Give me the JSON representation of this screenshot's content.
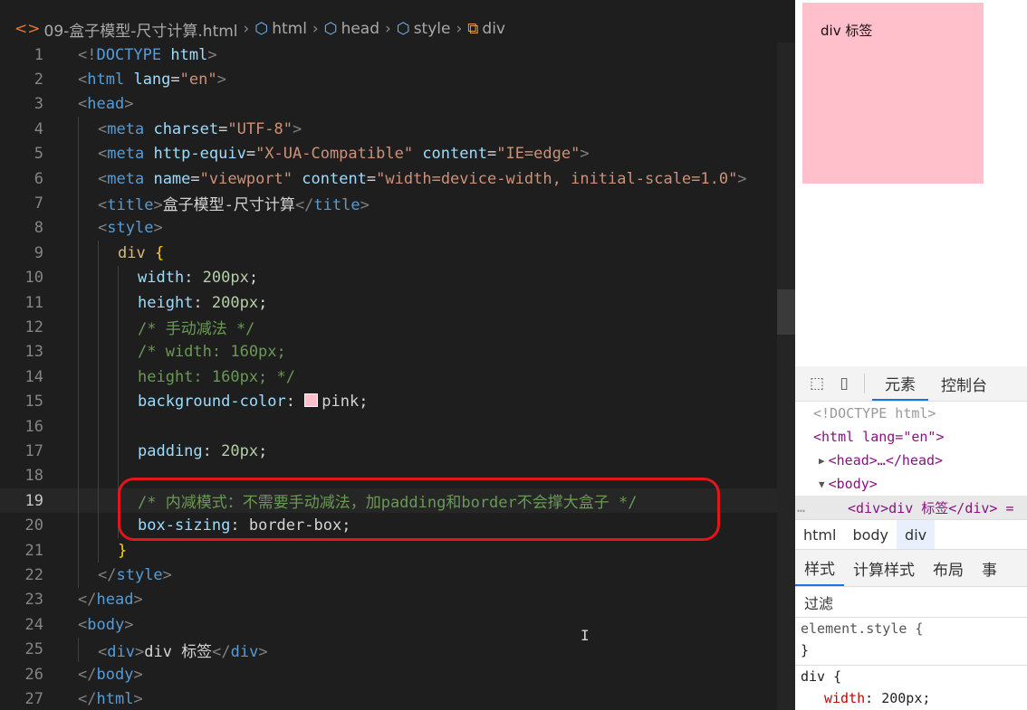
{
  "breadcrumb": {
    "file": "09-盒子模型-尺寸计算.html",
    "items": [
      "html",
      "head",
      "style",
      "div"
    ]
  },
  "editor": {
    "lines": [
      {
        "n": "1",
        "parts": [
          [
            "pn",
            "<!"
          ],
          [
            "tg",
            "DOCTYPE"
          ],
          [
            "tx",
            " "
          ],
          [
            "at",
            "html"
          ],
          [
            "pn",
            ">"
          ]
        ]
      },
      {
        "n": "2",
        "parts": [
          [
            "pn",
            "<"
          ],
          [
            "tg",
            "html"
          ],
          [
            "tx",
            " "
          ],
          [
            "at",
            "lang"
          ],
          [
            "tx",
            "="
          ],
          [
            "st",
            "\"en\""
          ],
          [
            "pn",
            ">"
          ]
        ]
      },
      {
        "n": "3",
        "parts": [
          [
            "pn",
            "<"
          ],
          [
            "tg",
            "head"
          ],
          [
            "pn",
            ">"
          ]
        ]
      },
      {
        "n": "4",
        "parts": [
          [
            "pn",
            "<"
          ],
          [
            "tg",
            "meta"
          ],
          [
            "tx",
            " "
          ],
          [
            "at",
            "charset"
          ],
          [
            "tx",
            "="
          ],
          [
            "st",
            "\"UTF-8\""
          ],
          [
            "pn",
            ">"
          ]
        ]
      },
      {
        "n": "5",
        "parts": [
          [
            "pn",
            "<"
          ],
          [
            "tg",
            "meta"
          ],
          [
            "tx",
            " "
          ],
          [
            "at",
            "http-equiv"
          ],
          [
            "tx",
            "="
          ],
          [
            "st",
            "\"X-UA-Compatible\""
          ],
          [
            "tx",
            " "
          ],
          [
            "at",
            "content"
          ],
          [
            "tx",
            "="
          ],
          [
            "st",
            "\"IE=edge\""
          ],
          [
            "pn",
            ">"
          ]
        ]
      },
      {
        "n": "6",
        "parts": [
          [
            "pn",
            "<"
          ],
          [
            "tg",
            "meta"
          ],
          [
            "tx",
            " "
          ],
          [
            "at",
            "name"
          ],
          [
            "tx",
            "="
          ],
          [
            "st",
            "\"viewport\""
          ],
          [
            "tx",
            " "
          ],
          [
            "at",
            "content"
          ],
          [
            "tx",
            "="
          ],
          [
            "st",
            "\"width=device-width, initial-scale=1.0\""
          ],
          [
            "pn",
            ">"
          ]
        ]
      },
      {
        "n": "7",
        "parts": [
          [
            "pn",
            "<"
          ],
          [
            "tg",
            "title"
          ],
          [
            "pn",
            ">"
          ],
          [
            "tx",
            "盒子模型-尺寸计算"
          ],
          [
            "pn",
            "</"
          ],
          [
            "tg",
            "title"
          ],
          [
            "pn",
            ">"
          ]
        ]
      },
      {
        "n": "8",
        "parts": [
          [
            "pn",
            "<"
          ],
          [
            "tg",
            "style"
          ],
          [
            "pn",
            ">"
          ]
        ]
      },
      {
        "n": "9",
        "parts": [
          [
            "sel",
            "div"
          ],
          [
            "tx",
            " "
          ],
          [
            "br",
            "{"
          ]
        ]
      },
      {
        "n": "10",
        "parts": [
          [
            "pr",
            "width"
          ],
          [
            "tx",
            ": "
          ],
          [
            "nm",
            "200px"
          ],
          [
            "tx",
            ";"
          ]
        ]
      },
      {
        "n": "11",
        "parts": [
          [
            "pr",
            "height"
          ],
          [
            "tx",
            ": "
          ],
          [
            "nm",
            "200px"
          ],
          [
            "tx",
            ";"
          ]
        ]
      },
      {
        "n": "12",
        "parts": [
          [
            "cm",
            "/* 手动减法 */"
          ]
        ]
      },
      {
        "n": "13",
        "parts": [
          [
            "cm",
            "/* width: 160px;"
          ]
        ]
      },
      {
        "n": "14",
        "parts": [
          [
            "cm",
            "height: 160px; */"
          ]
        ]
      },
      {
        "n": "15",
        "parts": [
          [
            "pr",
            "background-color"
          ],
          [
            "tx",
            ": "
          ],
          [
            "swatch",
            ""
          ],
          [
            "vl",
            "pink"
          ],
          [
            "tx",
            ";"
          ]
        ]
      },
      {
        "n": "16",
        "parts": []
      },
      {
        "n": "17",
        "parts": [
          [
            "pr",
            "padding"
          ],
          [
            "tx",
            ": "
          ],
          [
            "nm",
            "20px"
          ],
          [
            "tx",
            ";"
          ]
        ]
      },
      {
        "n": "18",
        "parts": []
      },
      {
        "n": "19",
        "parts": [
          [
            "cm",
            "/* 内减模式：不需要手动减法，加padding和border不会撑大盒子 */"
          ]
        ]
      },
      {
        "n": "20",
        "parts": [
          [
            "pr",
            "box-sizing"
          ],
          [
            "tx",
            ": "
          ],
          [
            "vl",
            "border-box"
          ],
          [
            "tx",
            ";"
          ]
        ]
      },
      {
        "n": "21",
        "parts": [
          [
            "br",
            "}"
          ]
        ]
      },
      {
        "n": "22",
        "parts": [
          [
            "pn",
            "</"
          ],
          [
            "tg",
            "style"
          ],
          [
            "pn",
            ">"
          ]
        ]
      },
      {
        "n": "23",
        "parts": [
          [
            "pn",
            "</"
          ],
          [
            "tg",
            "head"
          ],
          [
            "pn",
            ">"
          ]
        ]
      },
      {
        "n": "24",
        "parts": [
          [
            "pn",
            "<"
          ],
          [
            "tg",
            "body"
          ],
          [
            "pn",
            ">"
          ]
        ]
      },
      {
        "n": "25",
        "parts": [
          [
            "pn",
            "<"
          ],
          [
            "tg",
            "div"
          ],
          [
            "pn",
            ">"
          ],
          [
            "tx",
            "div 标签"
          ],
          [
            "pn",
            "</"
          ],
          [
            "tg",
            "div"
          ],
          [
            "pn",
            ">"
          ]
        ]
      },
      {
        "n": "26",
        "parts": [
          [
            "pn",
            "</"
          ],
          [
            "tg",
            "body"
          ],
          [
            "pn",
            ">"
          ]
        ]
      },
      {
        "n": "27",
        "parts": [
          [
            "pn",
            "</"
          ],
          [
            "tg",
            "html"
          ],
          [
            "pn",
            ">"
          ]
        ]
      }
    ],
    "current_line": "19"
  },
  "preview": {
    "div_text": "div 标签",
    "div_background": "#ffc0cb"
  },
  "devtools": {
    "tabs": [
      "元素",
      "控制台"
    ],
    "active_tab": "元素",
    "dom": {
      "doctype": "<!DOCTYPE html>",
      "html_open": "<html lang=\"en\">",
      "head": "<head>…</head>",
      "body": "<body>",
      "div": "<div>div 标签</div> =",
      "ellipsis": "…"
    },
    "crumbs": [
      "html",
      "body",
      "div"
    ],
    "active_crumb": "div",
    "style_tabs": [
      "样式",
      "计算样式",
      "布局",
      "事"
    ],
    "active_style_tab": "样式",
    "filter_label": "过滤",
    "rules": {
      "element_style_open": "element.style {",
      "element_style_close": "}",
      "div_open": "div {",
      "width_prop": "width",
      "width_value": "200px;"
    }
  }
}
